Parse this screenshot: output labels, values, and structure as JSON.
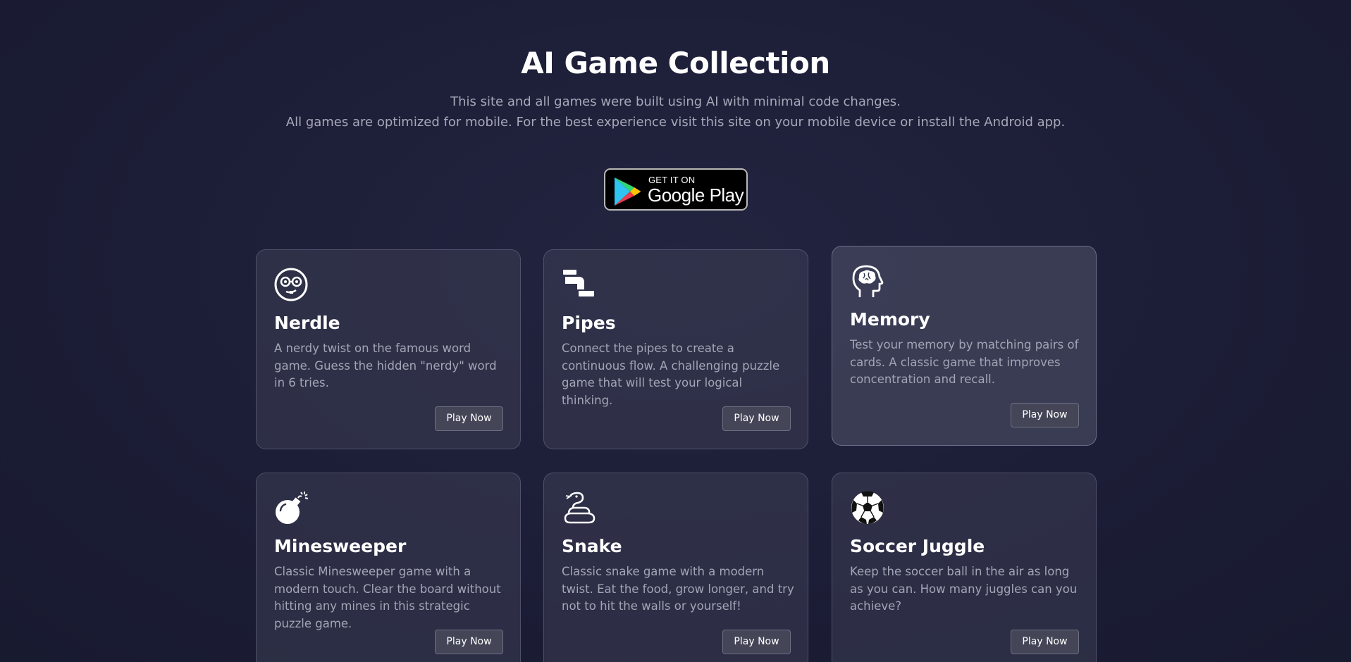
{
  "header": {
    "title": "AI Game Collection",
    "subtitle_1": "This site and all games were built using AI with minimal code changes.",
    "subtitle_2": "All games are optimized for mobile. For the best experience visit this site on your mobile device or install the Android app."
  },
  "store_badge": {
    "small_text": "GET IT ON",
    "big_text": "Google Play",
    "icon": "google-play-icon"
  },
  "games": [
    {
      "name": "Nerdle",
      "icon": "nerd-face-icon",
      "description": "A nerdy twist on the famous word game. Guess the hidden \"nerdy\" word in 6 tries.",
      "button": "Play Now"
    },
    {
      "name": "Pipes",
      "icon": "pipe-icon",
      "description": "Connect the pipes to create a continuous flow. A challenging puzzle game that will test your logical thinking.",
      "button": "Play Now"
    },
    {
      "name": "Memory",
      "icon": "brain-head-icon",
      "description": "Test your memory by matching pairs of cards. A classic game that improves concentration and recall.",
      "button": "Play Now"
    },
    {
      "name": "Minesweeper",
      "icon": "bomb-icon",
      "description": "Classic Minesweeper game with a modern touch. Clear the board without hitting any mines in this strategic puzzle game.",
      "button": "Play Now"
    },
    {
      "name": "Snake",
      "icon": "snake-icon",
      "description": "Classic snake game with a modern twist. Eat the food, grow longer, and try not to hit the walls or yourself!",
      "button": "Play Now"
    },
    {
      "name": "Soccer Juggle",
      "icon": "soccer-ball-icon",
      "description": "Keep the soccer ball in the air as long as you can. How many juggles can you achieve?",
      "button": "Play Now"
    }
  ],
  "colors": {
    "background": "#1c1d36",
    "card": "#2e3048",
    "muted_text": "#a6a8b8",
    "button": "#444658"
  }
}
